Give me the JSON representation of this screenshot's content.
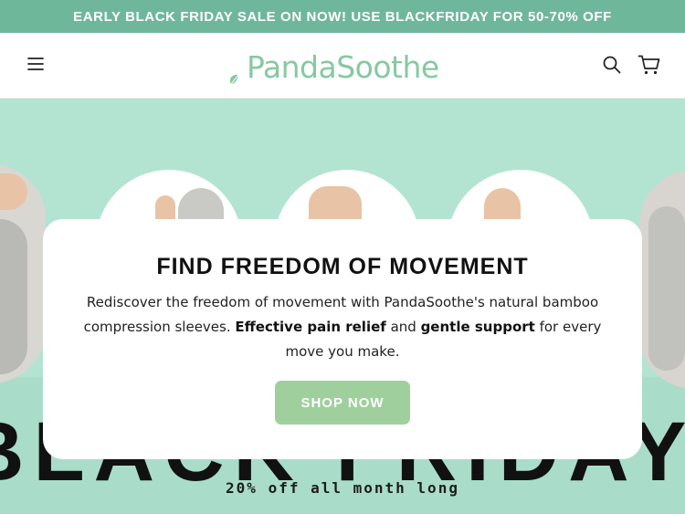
{
  "announcement": {
    "text": "EARLY BLACK FRIDAY SALE ON NOW! USE BLACKFRIDAY FOR 50-70% OFF"
  },
  "header": {
    "logo_text": "PandaSoothe",
    "icons": {
      "menu": "hamburger-menu-icon",
      "search": "search-icon",
      "cart": "cart-icon"
    }
  },
  "hero": {
    "title": "FIND FREEDOM OF MOVEMENT",
    "body_parts": [
      "Rediscover the freedom of movement with PandaSoothe's natural bamboo compression sleeves. ",
      "Effective pain relief",
      " and ",
      "gentle support",
      " for every move you make."
    ],
    "cta_label": "SHOP NOW",
    "background_word": "BLACK FRIDAY",
    "offer_text": "20% off all month long"
  },
  "colors": {
    "announcement_bg": "#6fb79b",
    "brand_green": "#86c9a1",
    "hero_bg": "#b3e4d2",
    "cta_bg": "#9fcf9d"
  }
}
